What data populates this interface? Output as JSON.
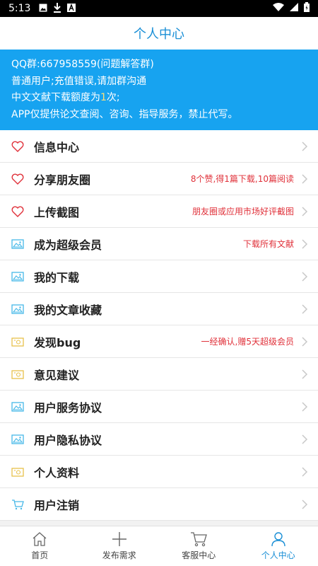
{
  "statusbar": {
    "time": "5:13"
  },
  "header": {
    "title": "个人中心"
  },
  "notice": {
    "line1": "QQ群:667958559(问题解答群)",
    "line2": "普通用户;充值错误,请加群沟通",
    "line3_before": "中文文献下载额度为",
    "line3_count": "1",
    "line3_after": "次;",
    "line4": "APP仅提供论文查阅、咨询、指导服务，禁止代写。"
  },
  "menu": {
    "items": [
      {
        "label": "信息中心",
        "hint": "",
        "icon": "heart-icon"
      },
      {
        "label": "分享朋友圈",
        "hint": "8个赞,得1篇下载,10篇阅读",
        "icon": "heart-icon"
      },
      {
        "label": "上传截图",
        "hint": "朋友圈或应用市场好评截图",
        "icon": "heart-icon"
      },
      {
        "label": "成为超级会员",
        "hint": "下载所有文献",
        "icon": "image-icon"
      },
      {
        "label": "我的下载",
        "hint": "",
        "icon": "image-icon"
      },
      {
        "label": "我的文章收藏",
        "hint": "",
        "icon": "image-icon"
      },
      {
        "label": "发现bug",
        "hint": "一经确认,赠5天超级会员",
        "icon": "ticket-icon"
      },
      {
        "label": "意见建议",
        "hint": "",
        "icon": "ticket-icon"
      },
      {
        "label": "用户服务协议",
        "hint": "",
        "icon": "image-icon"
      },
      {
        "label": "用户隐私协议",
        "hint": "",
        "icon": "image-icon"
      },
      {
        "label": "个人资料",
        "hint": "",
        "icon": "ticket-icon"
      },
      {
        "label": "用户注销",
        "hint": "",
        "icon": "cart-icon"
      }
    ]
  },
  "tabbar": {
    "tabs": [
      {
        "label": "首页",
        "icon": "home-icon"
      },
      {
        "label": "发布需求",
        "icon": "plus-icon"
      },
      {
        "label": "客服中心",
        "icon": "cart-icon"
      },
      {
        "label": "个人中心",
        "icon": "person-icon"
      }
    ]
  },
  "colors": {
    "accent": "#1a8fd6",
    "notice_bg": "#17a3f0",
    "hint": "#e0313a"
  }
}
